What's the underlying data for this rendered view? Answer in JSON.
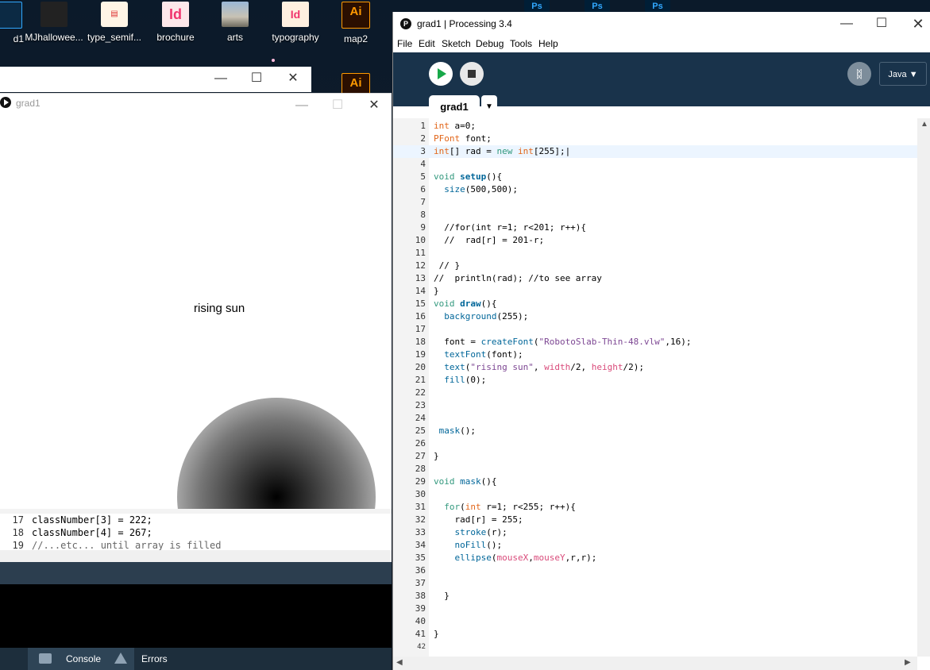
{
  "desktop": {
    "icons": [
      {
        "label": "d1",
        "kind": "dark"
      },
      {
        "label": "MJhallowee...",
        "kind": "dark"
      },
      {
        "label": "type_semif...",
        "kind": "pdf"
      },
      {
        "label": "brochure",
        "kind": "id"
      },
      {
        "label": "arts",
        "kind": "img"
      },
      {
        "label": "typography",
        "kind": "id"
      },
      {
        "label": "map2",
        "kind": "ai"
      }
    ],
    "ai_badge": "Ai",
    "id_badge": "Id",
    "ps_badge": "Ps"
  },
  "sketch": {
    "title": "grad1",
    "text": "rising sun"
  },
  "background_code": [
    {
      "n": "17",
      "text": "classNumber[3] = 222;"
    },
    {
      "n": "18",
      "text": "classNumber[4] = 267;"
    },
    {
      "n": "19",
      "text": "//...etc... until array is filled"
    }
  ],
  "console_tabs": {
    "console": "Console",
    "errors": "Errors"
  },
  "ide": {
    "title": "grad1 | Processing 3.4",
    "logo": "P",
    "menu": [
      "File",
      "Edit",
      "Sketch",
      "Debug",
      "Tools",
      "Help"
    ],
    "mode": "Java ▼",
    "tab": "grad1",
    "tab_arrow": "▼",
    "current_line": 3
  }
}
